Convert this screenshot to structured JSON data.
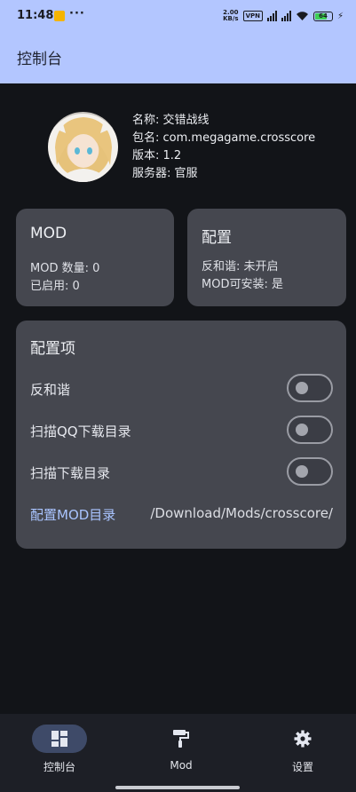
{
  "status_bar": {
    "time": "11:48",
    "more": "···",
    "net_speed_value": "2.00",
    "net_speed_unit": "KB/s",
    "vpn": "VPN",
    "battery": "64"
  },
  "app_bar": {
    "title": "控制台"
  },
  "game_info": {
    "name": "名称: 交错战线",
    "package": "包名: com.megagame.crosscore",
    "version": "版本: 1.2",
    "server": "服务器: 官服"
  },
  "mod_card": {
    "title": "MOD",
    "count": "MOD 数量: 0",
    "enabled": "已启用: 0"
  },
  "config_card": {
    "title": "配置",
    "anti_harmony": "反和谐: 未开启",
    "mod_installable": "MOD可安装: 是"
  },
  "options_card": {
    "title": "配置项",
    "options": [
      {
        "label": "反和谐",
        "enabled": false
      },
      {
        "label": "扫描QQ下载目录",
        "enabled": false
      },
      {
        "label": "扫描下载目录",
        "enabled": false
      }
    ],
    "mod_dir_label": "配置MOD目录",
    "mod_dir_path": "/Download/Mods/crosscore/"
  },
  "bottom_nav": {
    "items": [
      {
        "label": "控制台",
        "icon": "dashboard-icon",
        "active": true
      },
      {
        "label": "Mod",
        "icon": "paint-roller-icon",
        "active": false
      },
      {
        "label": "设置",
        "icon": "gear-icon",
        "active": false
      }
    ]
  },
  "colors": {
    "app_bar": "#b3c6ff",
    "background": "#121418",
    "card": "#45474f",
    "link": "#a9c4ff",
    "nav_active_pill": "#3e4a68"
  }
}
